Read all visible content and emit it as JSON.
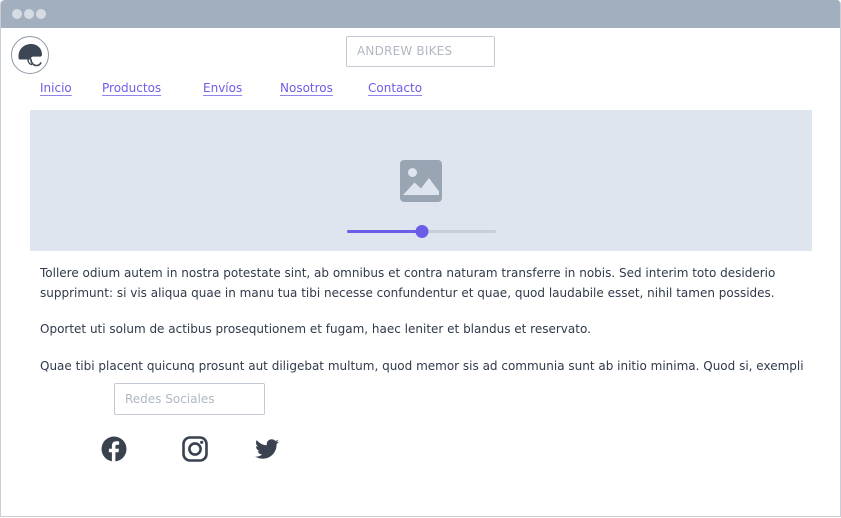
{
  "window": {
    "controls": [
      "dot",
      "dot",
      "dot"
    ]
  },
  "header": {
    "logo_icon": "helmet-icon",
    "brand": "ANDREW BIKES"
  },
  "nav": {
    "items": [
      {
        "label": "Inicio"
      },
      {
        "label": "Productos"
      },
      {
        "label": "Envíos"
      },
      {
        "label": "Nosotros"
      },
      {
        "label": "Contacto"
      }
    ]
  },
  "hero": {
    "image_icon": "image-placeholder-icon",
    "slider_value": 0.5
  },
  "content": {
    "paragraphs": [
      "Tollere odium autem in nostra potestate sint, ab omnibus et contra naturam transferre in nobis. Sed interim toto desiderio supprimunt: si vis aliqua quae in manu tua tibi necesse confundentur et quae, quod laudabile esset, nihil tamen possides.",
      "Oportet uti solum de actibus prosequtionem et fugam, haec leniter et blandus et reservato.",
      "Quae tibi placent quicunq prosunt aut diligebat multum, quod memor sis ad communia sunt ab initio minima. Quod si, exempli"
    ]
  },
  "social": {
    "label": "Redes Sociales",
    "icons": [
      "facebook-icon",
      "instagram-icon",
      "twitter-icon"
    ]
  },
  "colors": {
    "accent": "#6c5ce7",
    "titlebar": "#a2afbf",
    "hero_bg": "#dfe5ee",
    "icon_gray": "#9aa5b4",
    "social_icon": "#3a4250"
  }
}
